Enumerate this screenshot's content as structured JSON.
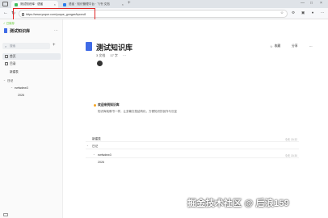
{
  "browser": {
    "tabs": [
      {
        "title": "测试知识库 · 语雀",
        "active": true
      },
      {
        "title": "语雀 · 知识管理平台 · 飞书·文档",
        "active": false
      }
    ],
    "new_tab_label": "+",
    "url": "https://www.yuque.com/yuque_gongze/bpovv8",
    "icons": [
      "back-icon",
      "forward-icon",
      "reload-icon"
    ],
    "window_controls": [
      "—",
      "□",
      "×"
    ]
  },
  "sidebar": {
    "notice": "✓ 已保存",
    "kb_title": "测试知识库",
    "search_placeholder": "搜索",
    "items": [
      {
        "label": "首页",
        "active": true
      },
      {
        "label": "目录",
        "active": false
      }
    ],
    "tree": [
      {
        "label": "新建表",
        "level": 0
      },
      {
        "label": "日记",
        "level": 0
      },
      {
        "label": "ewfwdew3",
        "level": 1
      },
      {
        "label": "2026",
        "level": 2
      }
    ]
  },
  "main": {
    "title": "测试知识库",
    "meta": [
      "3 文档",
      "17 字",
      "⋯"
    ],
    "actions": [
      {
        "icon": "star-icon",
        "label": "收藏"
      },
      {
        "icon": "share-icon",
        "label": "分享"
      },
      {
        "icon": "more-icon",
        "label": "⋯"
      }
    ],
    "welcome_title": "欢迎来到知识库",
    "welcome_sub": "知识库就像书一样，让多篇文档结构化，方便知识的创作与沉淀",
    "toc": [
      {
        "label": "新建表",
        "date": "今天 15:32",
        "level": 0
      },
      {
        "label": "日记",
        "date": "",
        "level": 0
      },
      {
        "label": "ewfwdew3",
        "date": "今天 15:30",
        "level": 1
      },
      {
        "label": "2026",
        "date": "",
        "level": 2
      }
    ]
  },
  "watermark": "掘金技术社区 @ 后浪159",
  "colors": {
    "accent": "#3f6be6",
    "highlight_box": "#e02020",
    "tab_favicon": "#3fbf5f"
  }
}
